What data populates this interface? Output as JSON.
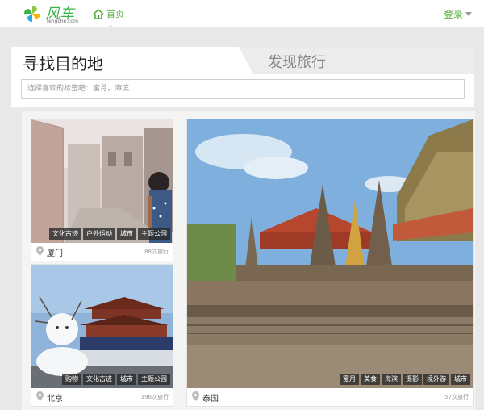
{
  "header": {
    "logo_name": "风车",
    "logo_domain": "fengche.com",
    "nav_home_label": "首页",
    "login_label": "登录",
    "accent_color": "#55b03c"
  },
  "search_panel": {
    "tab_find": "寻找目的地",
    "tab_discover": "发现旅行",
    "search_placeholder": "选择喜欢的标签吧：蜜月，海滨"
  },
  "destinations": [
    {
      "city": "厦门",
      "trips": "88次旅行",
      "tags": [
        "文化古迹",
        "户外运动",
        "城市",
        "主题公园"
      ]
    },
    {
      "city": "北京",
      "trips": "396次旅行",
      "tags": [
        "购物",
        "文化古迹",
        "城市",
        "主题公园"
      ]
    },
    {
      "city": "泰国",
      "trips": "57次旅行",
      "tags": [
        "蜜月",
        "美食",
        "海滨",
        "摄影",
        "境外游",
        "城市"
      ]
    }
  ]
}
